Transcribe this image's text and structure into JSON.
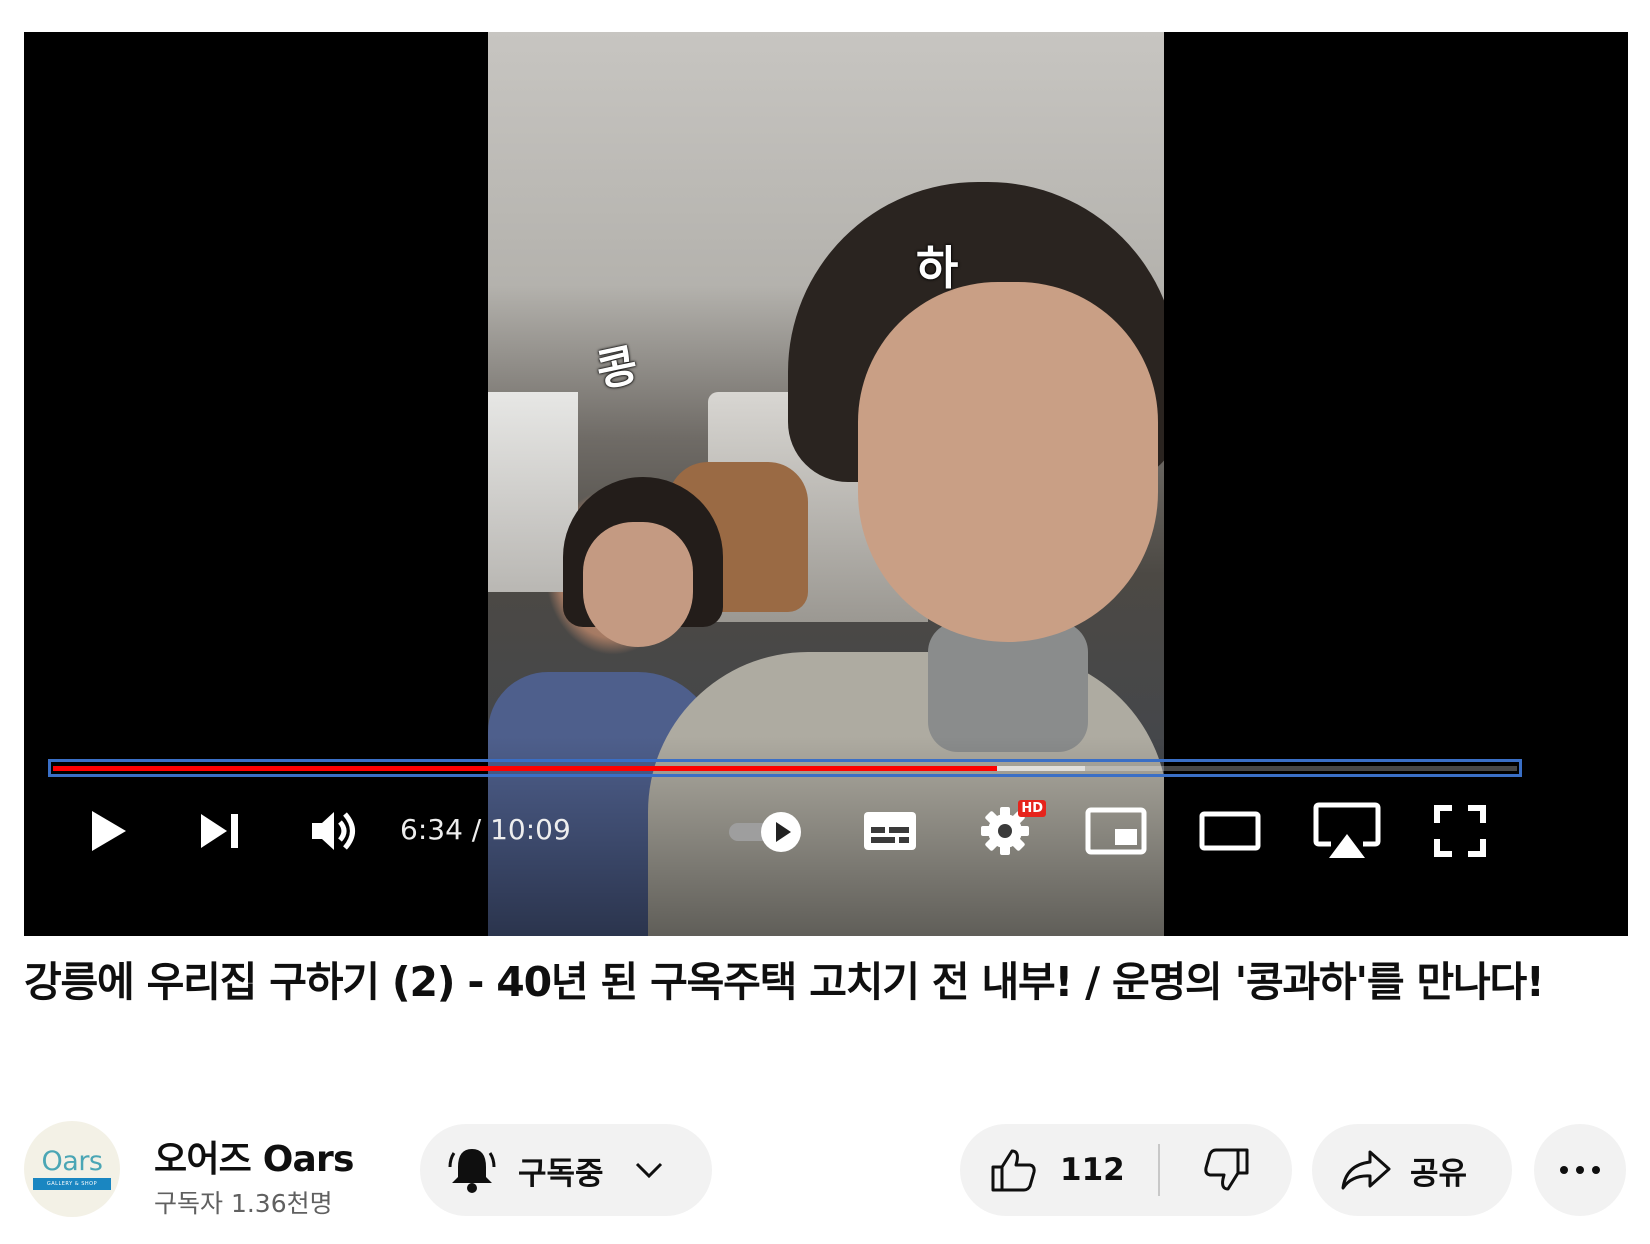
{
  "player": {
    "overlay_texts": [
      "하",
      "콩"
    ],
    "current_time": "6:34",
    "duration": "10:09",
    "time_display": "6:34 / 10:09",
    "progress_played": 0.645,
    "progress_buffered": 0.705,
    "controls": {
      "play_icon": "play-icon",
      "next_icon": "next-icon",
      "volume_icon": "volume-icon",
      "autoplay_icon": "autoplay-toggle-icon",
      "subtitles_icon": "subtitles-icon",
      "settings_icon": "settings-icon",
      "settings_badge": "HD",
      "miniplayer_icon": "miniplayer-icon",
      "theater_icon": "theater-mode-icon",
      "airplay_icon": "airplay-icon",
      "fullscreen_icon": "fullscreen-icon"
    },
    "colors": {
      "played": "#ff0000",
      "hd_badge": "#e6241c",
      "progress_outline": "#3a6fc6"
    }
  },
  "video": {
    "title": "강릉에 우리집 구하기 (2) - 40년 된 구옥주택 고치기 전 내부! / 운명의 '콩과하'를 만나다!"
  },
  "channel": {
    "avatar_logo_text": "Oars",
    "avatar_logo_subtext": "GALLERY & SHOP",
    "name": "오어즈 Oars",
    "subscribers": "구독자 1.36천명"
  },
  "actions": {
    "subscribe_label": "구독중",
    "like_count": "112",
    "share_label": "공유"
  }
}
